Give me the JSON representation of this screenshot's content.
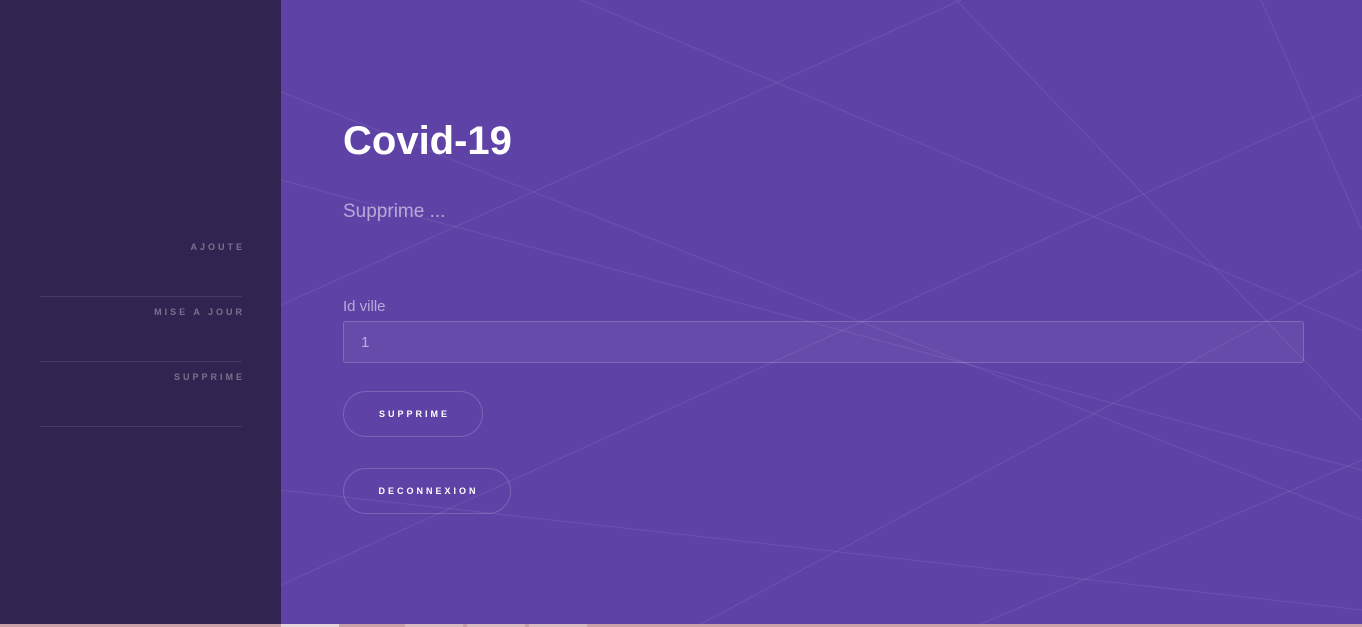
{
  "sidebar": {
    "items": [
      {
        "label": "AJOUTE"
      },
      {
        "label": "MISE A JOUR"
      },
      {
        "label": "SUPPRIME"
      }
    ]
  },
  "main": {
    "title": "Covid-19",
    "subtitle": "Supprime ...",
    "form": {
      "id_label": "Id ville",
      "id_value": "1",
      "submit_label": "SUPPRIME",
      "logout_label": "DECONNEXION"
    }
  },
  "colors": {
    "sidebar_bg": "#312450",
    "main_bg": "#5e42a6",
    "text": "#ffffff"
  }
}
